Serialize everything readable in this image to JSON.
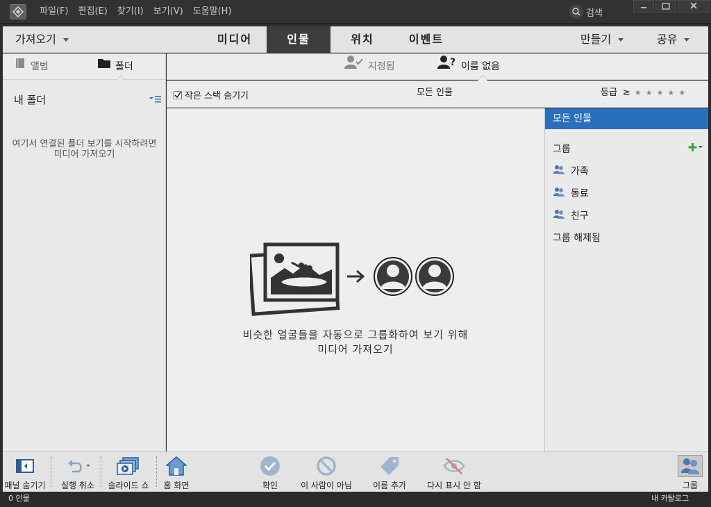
{
  "menu": [
    "파일(F)",
    "편집(E)",
    "찾기(I)",
    "보기(V)",
    "도움말(H)"
  ],
  "title_search": "검색",
  "nav": {
    "import_label": "가져오기",
    "tabs": [
      "미디어",
      "인물",
      "위치",
      "이벤트"
    ],
    "active_tab": "인물",
    "create_label": "만들기",
    "share_label": "공유"
  },
  "left_panel": {
    "tab_album": "앨범",
    "tab_folder": "폴더",
    "my_folders": "내 폴더",
    "empty_message": "여기서 연결된 폴더 보기를 시작하려면미디어 가져오기"
  },
  "people_tabs": {
    "named": "지정됨",
    "unnamed": "이름 없음"
  },
  "filter_bar": {
    "hide_small_stacks": "작은 스택 숨기기",
    "title": "모든 인물",
    "rating_label": "등급",
    "rating_op": "≥",
    "stars": [
      "★",
      "★",
      "★",
      "★",
      "★"
    ]
  },
  "canvas": {
    "line1": "비슷한 얼굴들을 자동으로 그룹화하여 보기 위해",
    "line2": "미디어 가져오기"
  },
  "right_panel": {
    "all_people": "모든 인물",
    "groups_label": "그룹",
    "groups": [
      "가족",
      "동료",
      "친구"
    ],
    "ungrouped": "그룹 해제됨"
  },
  "toolbar": {
    "hide_panel": "패널 숨기기",
    "undo": "실행 취소",
    "slideshow": "슬라이드 쇼",
    "home": "홈 화면",
    "confirm": "확인",
    "not_this_person": "이 사람이 아님",
    "add_name": "이름 추가",
    "dont_show_again": "다시 표시 안 함",
    "groups": "그룹"
  },
  "status": {
    "count": "0 인물",
    "catalog": "내 카탈로그"
  },
  "colors": {
    "accent": "#2a6fbd",
    "active_tab_bg": "#3d3d3d",
    "add_green": "#3aa53a"
  }
}
